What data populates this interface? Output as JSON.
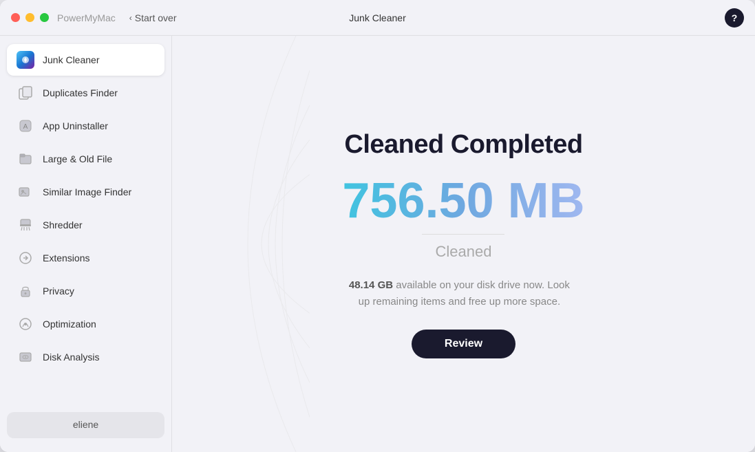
{
  "window": {
    "title": "Junk Cleaner",
    "app_name": "PowerMyMac",
    "start_over_label": "Start over",
    "help_label": "?"
  },
  "sidebar": {
    "items": [
      {
        "id": "junk-cleaner",
        "label": "Junk Cleaner",
        "active": true,
        "icon": "broom"
      },
      {
        "id": "duplicates-finder",
        "label": "Duplicates Finder",
        "active": false,
        "icon": "copy"
      },
      {
        "id": "app-uninstaller",
        "label": "App Uninstaller",
        "active": false,
        "icon": "trash"
      },
      {
        "id": "large-old-file",
        "label": "Large & Old File",
        "active": false,
        "icon": "briefcase"
      },
      {
        "id": "similar-image-finder",
        "label": "Similar Image Finder",
        "active": false,
        "icon": "image"
      },
      {
        "id": "shredder",
        "label": "Shredder",
        "active": false,
        "icon": "shredder"
      },
      {
        "id": "extensions",
        "label": "Extensions",
        "active": false,
        "icon": "extensions"
      },
      {
        "id": "privacy",
        "label": "Privacy",
        "active": false,
        "icon": "lock"
      },
      {
        "id": "optimization",
        "label": "Optimization",
        "active": false,
        "icon": "gauge"
      },
      {
        "id": "disk-analysis",
        "label": "Disk Analysis",
        "active": false,
        "icon": "disk"
      }
    ],
    "user": {
      "name": "eliene"
    }
  },
  "content": {
    "heading": "Cleaned Completed",
    "amount": "756.50 MB",
    "cleaned_label": "Cleaned",
    "disk_gb": "48.14 GB",
    "disk_message": " available on your disk drive now. Look up remaining items and free up more space.",
    "review_button_label": "Review"
  }
}
